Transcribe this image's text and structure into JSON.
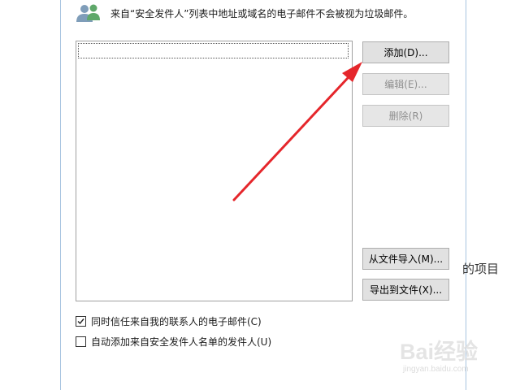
{
  "dialog": {
    "info_text": "来自“安全发件人”列表中地址或域名的电子邮件不会被视为垃圾邮件。",
    "info_icon": "people-icon"
  },
  "list": {
    "items": []
  },
  "buttons": {
    "add": "添加(D)...",
    "edit": "编辑(E)...",
    "delete": "删除(R)",
    "import": "从文件导入(M)...",
    "export": "导出到文件(X)..."
  },
  "options": {
    "trust_contacts": {
      "label": "同时信任来自我的联系人的电子邮件(C)",
      "checked": true
    },
    "auto_add_recipients": {
      "label": "自动添加来自安全发件人名单的发件人(U)",
      "checked": false
    }
  },
  "background": {
    "partial_text": "的项目"
  },
  "watermark": {
    "main": "Bai经验",
    "sub": "jingyan.baidu.com"
  },
  "colors": {
    "arrow": "#e5262b",
    "button_face": "#e1e1e1",
    "button_border": "#adadad",
    "disabled_text": "#8f8f8f"
  }
}
